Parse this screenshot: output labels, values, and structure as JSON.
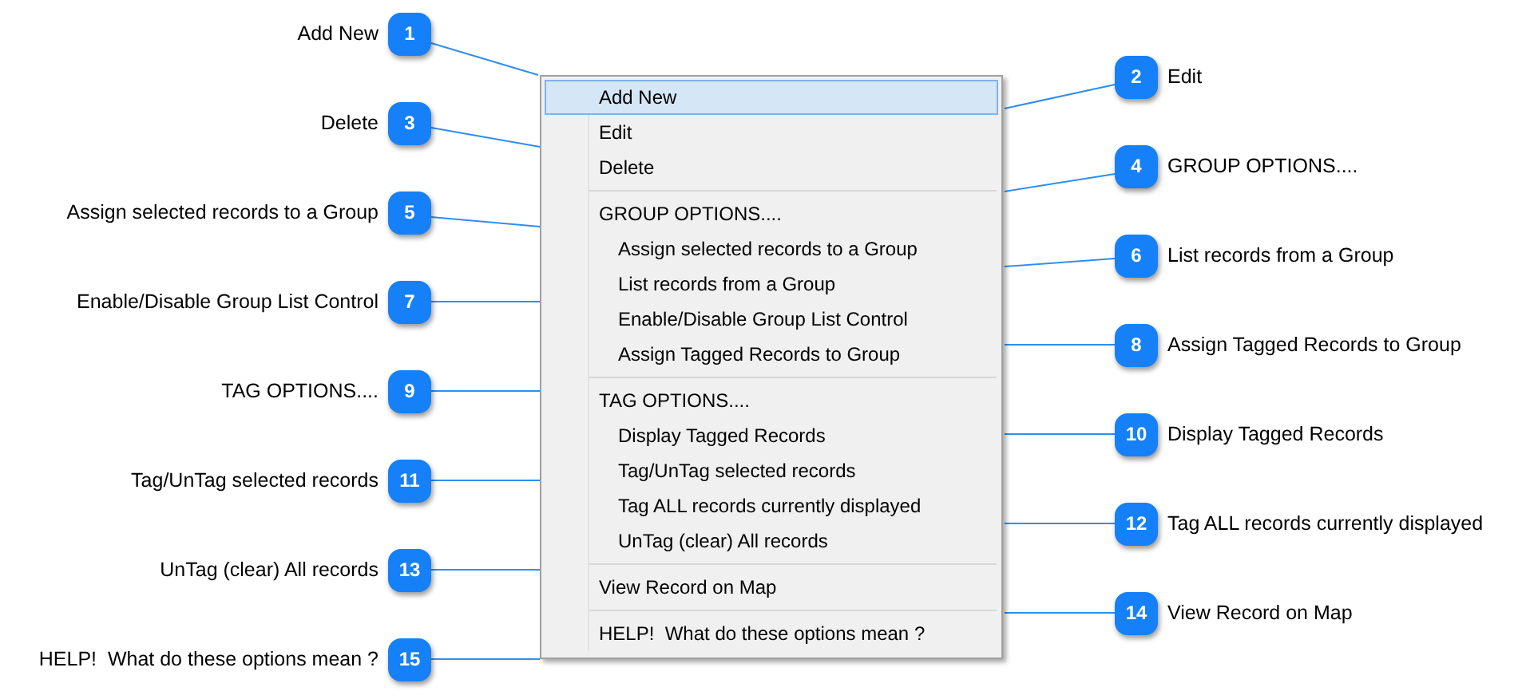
{
  "menu": {
    "items": [
      {
        "kind": "item",
        "label": "Add New",
        "selected": true
      },
      {
        "kind": "item",
        "label": "Edit",
        "selected": false
      },
      {
        "kind": "item",
        "label": "Delete",
        "selected": false
      },
      {
        "kind": "separator"
      },
      {
        "kind": "header",
        "label": "GROUP OPTIONS....",
        "selected": false
      },
      {
        "kind": "subitem",
        "label": "Assign selected records to a Group",
        "selected": false
      },
      {
        "kind": "subitem",
        "label": "List records from a Group",
        "selected": false
      },
      {
        "kind": "subitem",
        "label": "Enable/Disable Group List Control",
        "selected": false
      },
      {
        "kind": "subitem",
        "label": "Assign Tagged Records to Group",
        "selected": false
      },
      {
        "kind": "separator"
      },
      {
        "kind": "header",
        "label": "TAG OPTIONS....",
        "selected": false
      },
      {
        "kind": "subitem",
        "label": "Display Tagged Records",
        "selected": false
      },
      {
        "kind": "subitem",
        "label": "Tag/UnTag selected records",
        "selected": false
      },
      {
        "kind": "subitem",
        "label": "Tag ALL records currently displayed",
        "selected": false
      },
      {
        "kind": "subitem",
        "label": "UnTag (clear) All records",
        "selected": false
      },
      {
        "kind": "separator"
      },
      {
        "kind": "item",
        "label": "View Record on Map",
        "selected": false
      },
      {
        "kind": "separator"
      },
      {
        "kind": "item",
        "label": "HELP!  What do these options mean ?",
        "selected": false
      }
    ]
  },
  "callouts": [
    {
      "number": "1",
      "label": "Add New"
    },
    {
      "number": "2",
      "label": "Edit"
    },
    {
      "number": "3",
      "label": "Delete"
    },
    {
      "number": "4",
      "label": "GROUP OPTIONS...."
    },
    {
      "number": "5",
      "label": "Assign selected records to a Group"
    },
    {
      "number": "6",
      "label": "List records from a Group"
    },
    {
      "number": "7",
      "label": "Enable/Disable Group List Control"
    },
    {
      "number": "8",
      "label": "Assign Tagged Records to Group"
    },
    {
      "number": "9",
      "label": "TAG OPTIONS...."
    },
    {
      "number": "10",
      "label": "Display Tagged Records"
    },
    {
      "number": "11",
      "label": "Tag/UnTag selected records"
    },
    {
      "number": "12",
      "label": "Tag ALL records currently displayed"
    },
    {
      "number": "13",
      "label": "UnTag (clear) All records"
    },
    {
      "number": "14",
      "label": "View Record on Map"
    },
    {
      "number": "15",
      "label": "HELP!  What do these options mean ?"
    }
  ]
}
